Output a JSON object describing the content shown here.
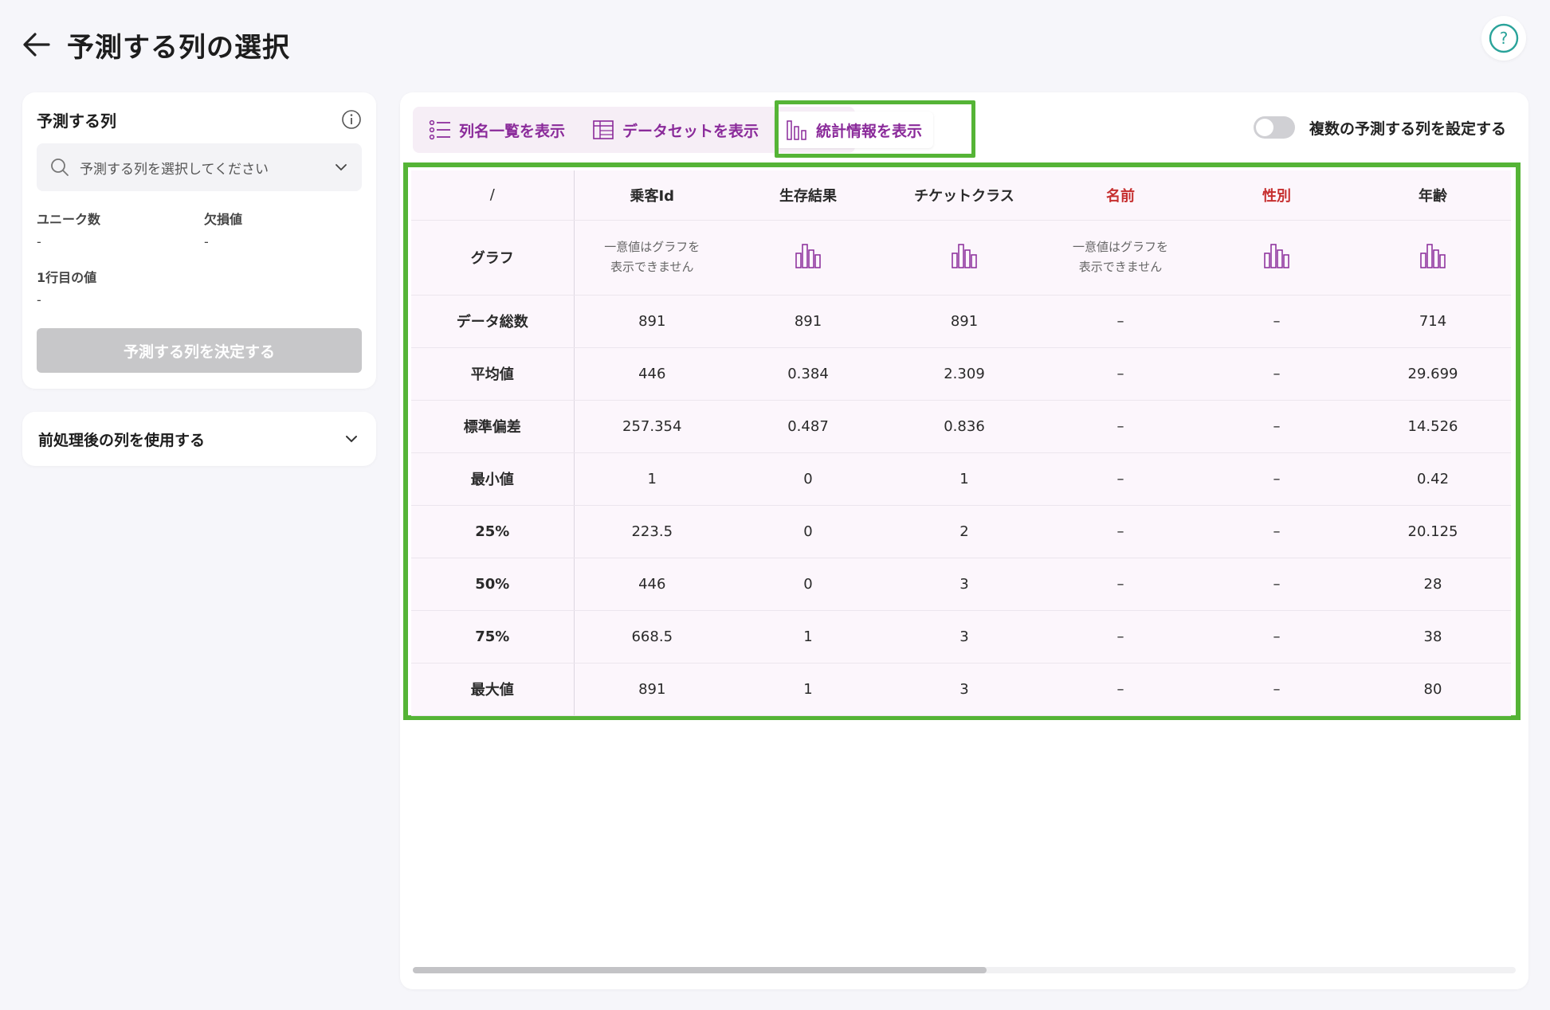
{
  "header": {
    "title": "予測する列の選択"
  },
  "left_panel": {
    "title": "予測する列",
    "select_placeholder": "予測する列を選択してください",
    "stats": [
      {
        "label": "ユニーク数",
        "value": "-"
      },
      {
        "label": "欠損値",
        "value": "-"
      },
      {
        "label": "1行目の値",
        "value": "-"
      }
    ],
    "decide_button": "予測する列を決定する",
    "preprocess_label": "前処理後の列を使用する"
  },
  "tabs": [
    {
      "label": "列名一覧を表示",
      "icon": "list-icon"
    },
    {
      "label": "データセットを表示",
      "icon": "dataset-icon"
    },
    {
      "label": "統計情報を表示",
      "icon": "bar-chart-icon"
    }
  ],
  "toggle_label": "複数の予測する列を設定する",
  "table": {
    "corner": "/",
    "columns": [
      {
        "name": "乗客Id",
        "warn": false,
        "graph": "note"
      },
      {
        "name": "生存結果",
        "warn": false,
        "graph": "icon"
      },
      {
        "name": "チケットクラス",
        "warn": false,
        "graph": "icon"
      },
      {
        "name": "名前",
        "warn": true,
        "graph": "note"
      },
      {
        "name": "性別",
        "warn": true,
        "graph": "icon"
      },
      {
        "name": "年齢",
        "warn": false,
        "graph": "icon"
      }
    ],
    "graph_row_label": "グラフ",
    "graph_note_line1": "一意値はグラフを",
    "graph_note_line2": "表示できません",
    "rows": [
      {
        "label": "データ総数",
        "values": [
          "891",
          "891",
          "891",
          "–",
          "–",
          "714"
        ]
      },
      {
        "label": "平均値",
        "values": [
          "446",
          "0.384",
          "2.309",
          "–",
          "–",
          "29.699"
        ]
      },
      {
        "label": "標準偏差",
        "values": [
          "257.354",
          "0.487",
          "0.836",
          "–",
          "–",
          "14.526"
        ]
      },
      {
        "label": "最小値",
        "values": [
          "1",
          "0",
          "1",
          "–",
          "–",
          "0.42"
        ]
      },
      {
        "label": "25%",
        "values": [
          "223.5",
          "0",
          "2",
          "–",
          "–",
          "20.125"
        ]
      },
      {
        "label": "50%",
        "values": [
          "446",
          "0",
          "3",
          "–",
          "–",
          "28"
        ]
      },
      {
        "label": "75%",
        "values": [
          "668.5",
          "1",
          "3",
          "–",
          "–",
          "38"
        ]
      },
      {
        "label": "最大値",
        "values": [
          "891",
          "1",
          "3",
          "–",
          "–",
          "80"
        ]
      }
    ]
  },
  "colors": {
    "accent": "#8a2a9a",
    "highlight": "#55b436",
    "warn": "#c62f2f"
  }
}
